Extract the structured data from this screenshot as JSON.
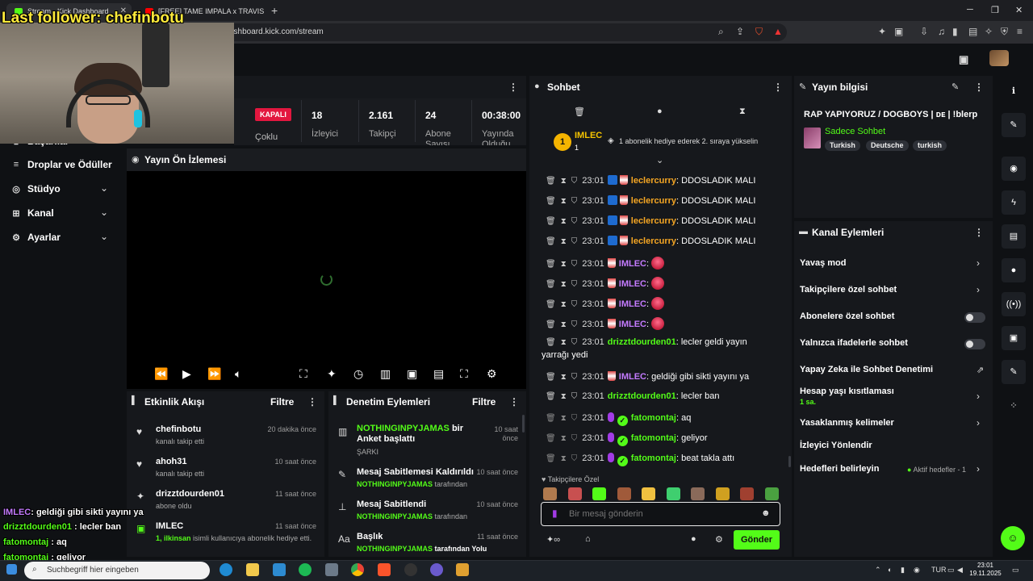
{
  "browser": {
    "tabs": [
      {
        "label": "Stream - Kick Dashboard"
      },
      {
        "label": "[FREE] TAME IMPALA x TRAVIS SCOT"
      }
    ],
    "url": "ashboard.kick.com/stream"
  },
  "overlay": {
    "last_follower": "Last follower: chefinbotu",
    "chat_lines": [
      {
        "user": "IMLEC",
        "text": ": geldiği gibi sikti yayını ya",
        "color": "#c47bff"
      },
      {
        "user": "drizztdourden01",
        "text": " : lecler ban",
        "color": "#53fc18"
      },
      {
        "user": "fatomontaj",
        "text": " : aq",
        "color": "#53fc18"
      },
      {
        "user": "fatomontaj",
        "text": " : geliyor",
        "color": "#53fc18"
      },
      {
        "user": "fatomontaj",
        "text": " : beat takla attı",
        "color": "#53fc18"
      }
    ]
  },
  "sidebar": {
    "items": [
      {
        "label": "Başarılar",
        "icon": "trophy-icon"
      },
      {
        "label": "Droplar ve Ödüller",
        "icon": "drops-icon"
      },
      {
        "label": "Stüdyo",
        "icon": "studio-icon"
      },
      {
        "label": "Kanal",
        "icon": "channel-icon"
      },
      {
        "label": "Ayarlar",
        "icon": "settings-icon"
      }
    ]
  },
  "stats": {
    "status": "KAPALI",
    "status_sub": "Çoklu",
    "viewers": {
      "value": "18",
      "label": "İzleyici"
    },
    "followers": {
      "value": "2.161",
      "label": "Takipçi"
    },
    "subs": {
      "value": "24",
      "label": "Abone Sayısı"
    },
    "uptime": {
      "value": "00:38:00",
      "label": "Yayında Olduğu"
    }
  },
  "preview": {
    "title": "Yayın Ön İzlemesi"
  },
  "activity": {
    "title": "Etkinlik Akışı",
    "filter": "Filtre",
    "items": [
      {
        "name": "chefinbotu",
        "sub": "kanalı takip etti",
        "time": "20 dakika önce",
        "icon": "heart-icon"
      },
      {
        "name": "ahoh31",
        "sub": "kanalı takip etti",
        "time": "10 saat önce",
        "icon": "heart-icon"
      },
      {
        "name": "drizztdourden01",
        "sub": "abone oldu",
        "time": "11 saat önce",
        "icon": "star-icon"
      },
      {
        "name": "IMLEC",
        "sub_highlight": "1, ilkinsan",
        "sub": " isimli kullanıcıya abonelik hediye etti.",
        "time": "11 saat önce",
        "icon": "gift-icon"
      }
    ]
  },
  "moderation": {
    "title": "Denetim Eylemleri",
    "filter": "Filtre",
    "items": [
      {
        "title_green": "NOTHINGINPYJAMAS",
        "title": " bir Anket başlattı",
        "sub": "ŞARKI",
        "time": "10 saat önce",
        "icon": "poll-icon"
      },
      {
        "title": "Mesaj Sabitlemesi Kaldırıldı",
        "sub_green": "NOTHINGINPYJAMAS",
        "sub": " tarafından",
        "time": "10 saat önce",
        "icon": "unpin-icon"
      },
      {
        "title": "Mesaj Sabitlendi",
        "sub_green": "NOTHINGINPYJAMAS",
        "sub": " tarafından",
        "time": "10 saat önce",
        "icon": "pin-icon"
      },
      {
        "title": "Başlık",
        "sub_green": "NOTHINGINPYJAMAS",
        "sub": " tarafından Yolu",
        "time": "11 saat önce",
        "icon": "title-icon"
      }
    ]
  },
  "chat": {
    "title": "Sohbet",
    "pinned_user": "IMLEC",
    "pinned_count": "1",
    "pinned_rank": "1",
    "pinned_text": "1 abonelik hediye ederek 2. sıraya yükselin",
    "messages": [
      {
        "time": "23:01",
        "user": "leclercurry",
        "text": ": DDOSLADIK MALI",
        "ucolor": "orange",
        "badges": [
          "b",
          "cup"
        ]
      },
      {
        "time": "23:01",
        "user": "leclercurry",
        "text": ": DDOSLADIK MALI",
        "ucolor": "orange",
        "badges": [
          "b",
          "cup"
        ]
      },
      {
        "time": "23:01",
        "user": "leclercurry",
        "text": ": DDOSLADIK MALI",
        "ucolor": "orange",
        "badges": [
          "b",
          "cup"
        ]
      },
      {
        "time": "23:01",
        "user": "leclercurry",
        "text": ": DDOSLADIK MALI",
        "ucolor": "orange",
        "badges": [
          "b",
          "cup"
        ]
      },
      {
        "time": "23:01",
        "user": "IMLEC",
        "text": ": ",
        "ucolor": "purple",
        "badges": [
          "cup"
        ],
        "emote": true
      },
      {
        "time": "23:01",
        "user": "IMLEC",
        "text": ": ",
        "ucolor": "purple",
        "badges": [
          "cup"
        ],
        "emote": true
      },
      {
        "time": "23:01",
        "user": "IMLEC",
        "text": ": ",
        "ucolor": "purple",
        "badges": [
          "cup"
        ],
        "emote": true
      },
      {
        "time": "23:01",
        "user": "IMLEC",
        "text": ": ",
        "ucolor": "purple",
        "badges": [
          "cup"
        ],
        "emote": true
      },
      {
        "time": "23:01",
        "user": "drizztdourden01",
        "text": ": lecler geldi yayın",
        "text2": "yarrağı yedi",
        "ucolor": "green",
        "badges": []
      },
      {
        "time": "23:01",
        "user": "IMLEC",
        "text": ": geldiği gibi sikti yayını ya",
        "ucolor": "purple",
        "badges": [
          "cup"
        ]
      },
      {
        "time": "23:01",
        "user": "drizztdourden01",
        "text": ": lecler ban",
        "ucolor": "green",
        "badges": []
      },
      {
        "time": "23:01",
        "user": "fatomontaj",
        "text": ": aq",
        "ucolor": "green",
        "badges": [
          "mic",
          "ver"
        ]
      },
      {
        "time": "23:01",
        "user": "fatomontaj",
        "text": ": geliyor",
        "ucolor": "green",
        "badges": [
          "mic",
          "ver"
        ]
      },
      {
        "time": "23:01",
        "user": "fatomontaj",
        "text": ": beat takla attı",
        "ucolor": "green",
        "badges": [
          "mic",
          "ver"
        ]
      }
    ],
    "followers_only_label": "Takipçilere Özel",
    "input_placeholder": "Bir mesaj gönderin",
    "send_label": "Gönder"
  },
  "stream_info": {
    "title": "Yayın bilgisi",
    "stream_title": "RAP YAPIYORUZ / DOGBOYS | ᴅᴇ | !blerp",
    "category": "Sadece Sohbet",
    "tags": [
      "Turkish",
      "Deutsche",
      "turkish"
    ]
  },
  "channel_actions": {
    "title": "Kanal Eylemleri",
    "items": [
      {
        "label": "Yavaş mod",
        "control": "chevron"
      },
      {
        "label": "Takipçilere özel sohbet",
        "control": "chevron"
      },
      {
        "label": "Abonelere özel sohbet",
        "control": "toggle"
      },
      {
        "label": "Yalnızca ifadelerle sohbet",
        "control": "toggle"
      },
      {
        "label": "Yapay Zeka ile Sohbet Denetimi",
        "control": "external"
      },
      {
        "label": "Hesap yaşı kısıtlaması",
        "sub": "1 sa.",
        "control": "chevron"
      },
      {
        "label": "Yasaklanmış kelimeler",
        "control": "chevron"
      },
      {
        "label": "İzleyici Yönlendir",
        "control": "none"
      },
      {
        "label": "Hedefleri belirleyin",
        "status": "Aktif hedefler - 1",
        "control": "chevron"
      }
    ]
  },
  "taskbar": {
    "search_placeholder": "Suchbegriff hier eingeben",
    "lang": "TUR",
    "time": "23:01",
    "date": "19.11.2025"
  },
  "colors": {
    "accent": "#53fc18",
    "offline": "#e3173f",
    "panel_bg": "#16181c",
    "page_bg": "#0f1114"
  }
}
